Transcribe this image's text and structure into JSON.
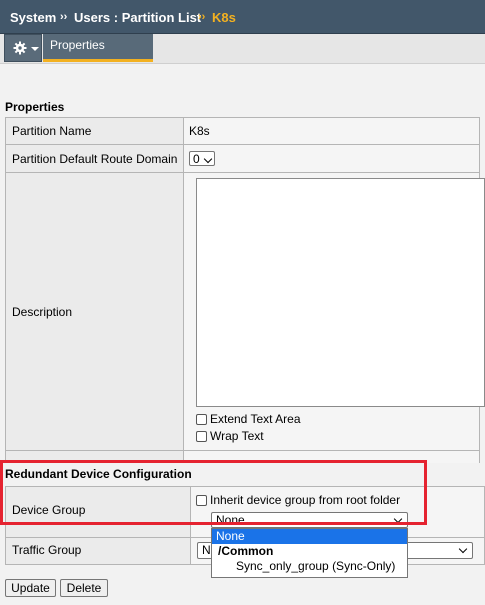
{
  "breadcrumb": {
    "items": [
      "System",
      "Users : Partition List"
    ],
    "current": "K8s",
    "separator": "››"
  },
  "tabbar": {
    "menu_icon": "gear-icon",
    "active_tab": "Properties"
  },
  "properties": {
    "title": "Properties",
    "partition_name_label": "Partition Name",
    "partition_name_value": "K8s",
    "route_domain_label": "Partition Default Route Domain",
    "route_domain_value": "0",
    "description_label": "Description",
    "description_value": "",
    "extend_text_area": "Extend Text Area",
    "wrap_text": "Wrap Text"
  },
  "redundant": {
    "title": "Redundant Device Configuration",
    "device_group_label": "Device Group",
    "inherit_label": "Inherit device group from root folder",
    "device_group_value": "None",
    "traffic_group_label": "Traffic Group",
    "traffic_group_value": "N"
  },
  "dropdown": {
    "options": [
      {
        "label": "None",
        "kind": "selected"
      },
      {
        "label": "/Common",
        "kind": "group"
      },
      {
        "label": "Sync_only_group (Sync-Only)",
        "kind": "child"
      }
    ]
  },
  "buttons": {
    "update": "Update",
    "delete": "Delete"
  },
  "colors": {
    "header_bg": "#42576a",
    "accent": "#f3b120",
    "highlight": "#e52330",
    "selected_option": "#1a73e8"
  }
}
